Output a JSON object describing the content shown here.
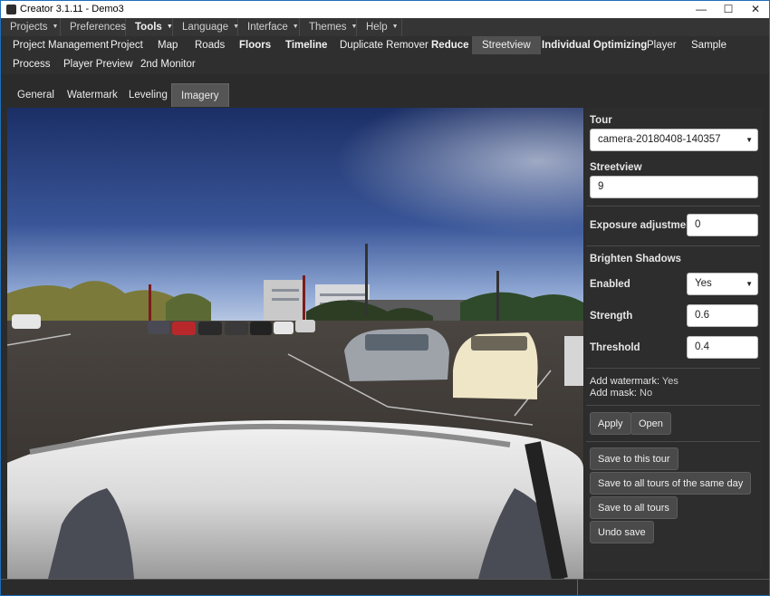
{
  "window": {
    "title": "Creator 3.1.11 - Demo3",
    "minimize_glyph": "—",
    "maximize_glyph": "☐",
    "close_glyph": "✕"
  },
  "menu": [
    {
      "label": "Projects",
      "bold": false
    },
    {
      "label": "Preferences",
      "bold": false
    },
    {
      "label": "Tools",
      "bold": true
    },
    {
      "label": "Language",
      "bold": false
    },
    {
      "label": "Interface",
      "bold": false
    },
    {
      "label": "Themes",
      "bold": false
    },
    {
      "label": "Help",
      "bold": false
    }
  ],
  "toolbar_row1": [
    "Project Management",
    "Project",
    "Map",
    "Roads",
    "Floors",
    "Timeline",
    "Duplicate Remover",
    "Reduce",
    "Streetview",
    "Individual Optimizing",
    "Player",
    "Sample"
  ],
  "toolbar_row2": [
    "Process",
    "Player Preview",
    "2nd Monitor"
  ],
  "active_tool": "Streetview",
  "subtabs": [
    "General",
    "Watermark",
    "Leveling",
    "Imagery"
  ],
  "active_subtab": "Imagery",
  "panel": {
    "tour_label": "Tour",
    "tour_value": "camera-20180408-140357",
    "streetview_label": "Streetview",
    "streetview_value": "9",
    "exposure_label": "Exposure adjustment",
    "exposure_value": "0",
    "brighten_shadows_label": "Brighten Shadows",
    "enabled_label": "Enabled",
    "enabled_value": "Yes",
    "strength_label": "Strength",
    "strength_value": "0.6",
    "threshold_label": "Threshold",
    "threshold_value": "0.4",
    "watermark_label": "Add watermark:",
    "watermark_value": "Yes",
    "mask_label": "Add mask:",
    "mask_value": "No",
    "apply_button": "Apply",
    "open_button": "Open",
    "save_tour_button": "Save to this tour",
    "save_same_day_button": "Save to all tours of the same day",
    "save_all_button": "Save to all tours",
    "undo_button": "Undo save"
  },
  "colors": {
    "background": "#2b2b2b",
    "active_tab": "#505050",
    "sky_top": "#1b2f66",
    "sky_horizon": "#b6c6e2"
  }
}
